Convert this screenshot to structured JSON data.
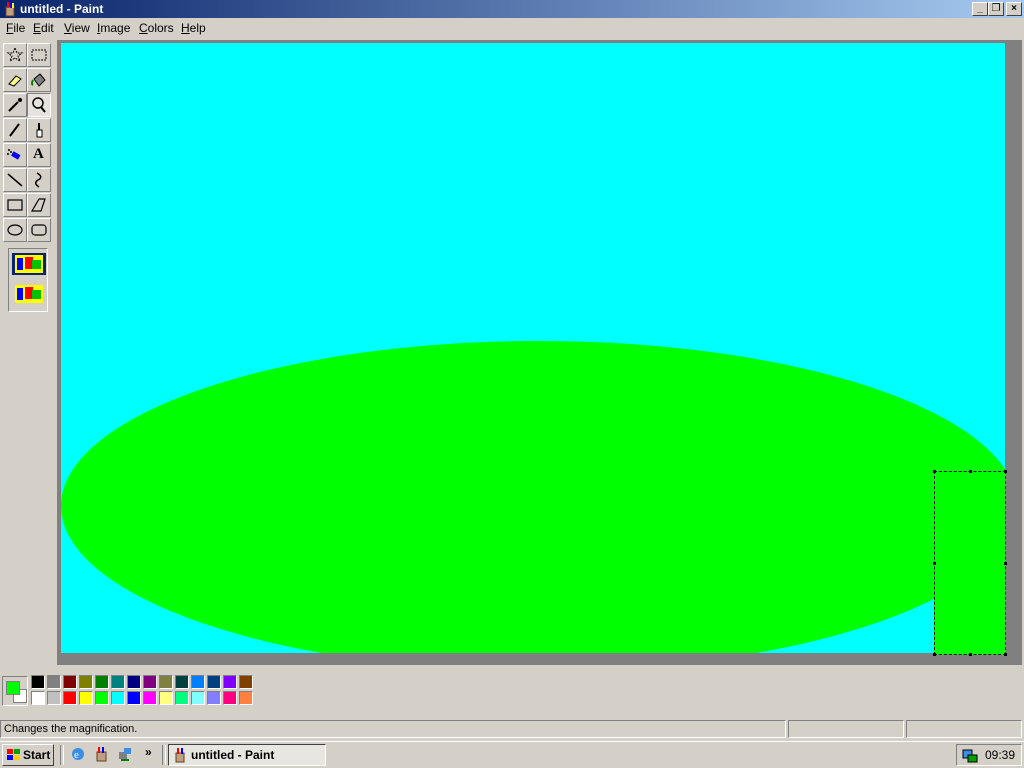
{
  "window": {
    "title": "untitled - Paint",
    "minimize_glyph": "_",
    "restore_glyph": "❐",
    "close_glyph": "×"
  },
  "menu": {
    "items": [
      {
        "key": "F",
        "rest": "ile"
      },
      {
        "key": "E",
        "rest": "dit"
      },
      {
        "key": "V",
        "rest": "iew"
      },
      {
        "key": "I",
        "rest": "mage"
      },
      {
        "key": "C",
        "rest": "olors"
      },
      {
        "key": "H",
        "rest": "elp"
      }
    ]
  },
  "tools": [
    {
      "name": "free-form-select-tool",
      "icon": "star-select-icon"
    },
    {
      "name": "select-tool",
      "icon": "rect-select-icon"
    },
    {
      "name": "eraser-tool",
      "icon": "eraser-icon"
    },
    {
      "name": "fill-tool",
      "icon": "paint-bucket-icon"
    },
    {
      "name": "pick-color-tool",
      "icon": "eyedropper-icon"
    },
    {
      "name": "magnifier-tool",
      "icon": "magnifier-icon",
      "active": true
    },
    {
      "name": "pencil-tool",
      "icon": "pencil-icon"
    },
    {
      "name": "brush-tool",
      "icon": "brush-icon"
    },
    {
      "name": "airbrush-tool",
      "icon": "airbrush-icon"
    },
    {
      "name": "text-tool",
      "icon": "text-icon",
      "label": "A"
    },
    {
      "name": "line-tool",
      "icon": "line-icon"
    },
    {
      "name": "curve-tool",
      "icon": "curve-icon"
    },
    {
      "name": "rectangle-tool",
      "icon": "rectangle-icon"
    },
    {
      "name": "polygon-tool",
      "icon": "polygon-icon"
    },
    {
      "name": "ellipse-tool",
      "icon": "ellipse-icon"
    },
    {
      "name": "rounded-rectangle-tool",
      "icon": "rounded-rect-icon"
    }
  ],
  "canvas": {
    "background": "#00ffff",
    "ellipse_color": "#00ff00"
  },
  "palette": {
    "foreground": "#00ff00",
    "background": "#ffffff",
    "row1": [
      "#000000",
      "#808080",
      "#800000",
      "#808000",
      "#008000",
      "#008080",
      "#000080",
      "#800080",
      "#808040",
      "#004040",
      "#0080ff",
      "#004080",
      "#8000ff",
      "#804000"
    ],
    "row2": [
      "#ffffff",
      "#c0c0c0",
      "#ff0000",
      "#ffff00",
      "#00ff00",
      "#00ffff",
      "#0000ff",
      "#ff00ff",
      "#ffff80",
      "#00ff80",
      "#80ffff",
      "#8080ff",
      "#ff0080",
      "#ff8040"
    ]
  },
  "status": {
    "message": "Changes the magnification."
  },
  "taskbar": {
    "start_label": "Start",
    "chevron": "»",
    "task_label": "untitled - Paint",
    "clock": "09:39"
  }
}
